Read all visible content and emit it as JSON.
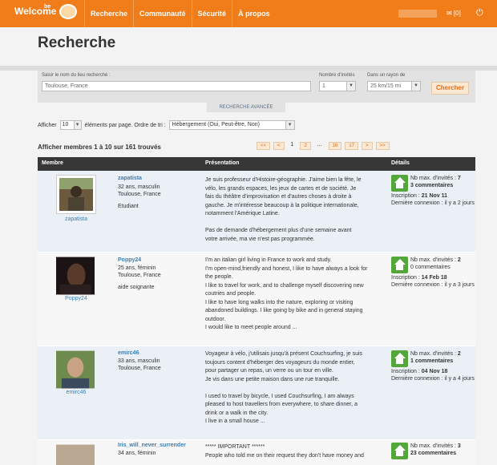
{
  "nav": {
    "logo": "Welcome",
    "logo_sup": "be",
    "items": [
      "Recherche",
      "Communauté",
      "Sécurité",
      "À propos"
    ],
    "messages": "[0]"
  },
  "page": {
    "title": "Recherche"
  },
  "search": {
    "place_label": "Saisir le nom du lieu recherché :",
    "place_value": "Toulouse, France",
    "guests_label": "Nombre d'invités",
    "guests_value": "1",
    "radius_label": "Dans un rayon de",
    "radius_value": "25 km/15 mi",
    "button": "Chercher",
    "advanced": "RECHERCHE AVANCÉE"
  },
  "listing": {
    "show_label": "Afficher",
    "per_page": "10",
    "per_page_label": "éléments par page. Ordre de tri :",
    "sort_value": "Hébergement (Oui, Peut-être, Non)",
    "results": "Afficher membres 1 à 10 sur 161 trouvés",
    "pager": [
      "<<",
      "<",
      "1",
      "2",
      "...",
      "16",
      "17",
      ">",
      ">>"
    ]
  },
  "table": {
    "headers": {
      "member": "Membre",
      "presentation": "Présentation",
      "details": "Détails"
    },
    "rows": [
      {
        "username": "zapatista",
        "age_gender": "32 ans, masculin",
        "location": "Toulouse, France",
        "occupation": "Etudiant",
        "presentation": [
          "Je suis professeur d'Histoire-géographie. J'aime bien la fête, le",
          "vélo, les grands espaces, les jeux de cartes et de société. Je",
          "fais du théâtre d'improvisation et d'autres choses à droite à",
          "gauche. Je m'intéresse beaucoup à la politique internationale,",
          "notamment l'Amérique Latine.",
          "",
          "Pas de demande d'hébergement plus d'une semaine avant",
          "votre arrivée, ma vie n'est pas programmée."
        ],
        "max_guests_label": "Nb max. d'invités :",
        "max_guests": "7",
        "comments": "3 commentaires",
        "signup_label": "Inscription :",
        "signup": "21 Nov 11",
        "last_login": "Dernière connexion : il y a 2 jours"
      },
      {
        "username": "Poppy24",
        "age_gender": "25 ans, féminin",
        "location": "Toulouse, France",
        "occupation": "aide soignante",
        "presentation": [
          "I'm an italian girl living in France to work and study.",
          "I'm open-mind,friendly and honest, I like to have always a look for",
          "the people.",
          "I like to travel for work, and to challenge myself discovering new",
          "coutries and people.",
          "I like to have long walks into the nature, exploring or visiting",
          "abandoned buildings. I like going by bike and in general staying",
          "outdoor.",
          "I would like to meet people around ..."
        ],
        "max_guests_label": "Nb max. d'invités :",
        "max_guests": "2",
        "comments": "0 commentaires",
        "signup_label": "Inscription :",
        "signup": "14 Feb 18",
        "last_login": "Dernière connexion : il y a 3 jours"
      },
      {
        "username": "emirc46",
        "age_gender": "33 ans, masculin",
        "location": "Toulouse, France",
        "occupation": "",
        "presentation": [
          "Voyageur à vélo, j'utilisais jusqu'à présent Couchsurfing, je suis",
          "toujours content d'héberger des voyageurs du monde entier,",
          "pour partager un repas, un verre ou un tour en ville.",
          "Je vis dans une petite maison dans une rue tranquille.",
          "",
          "I used to travel by bicycle, I used Couchsurfing, I am always",
          "pleased to host travellers from everywhere, to share dinner, a",
          "drink or a walk in the city.",
          "I live in a small house ..."
        ],
        "max_guests_label": "Nb max. d'invités :",
        "max_guests": "2",
        "comments": "1 commentaires",
        "signup_label": "Inscription :",
        "signup": "04 Nov 18",
        "last_login": "Dernière connexion : il y a 4 jours"
      },
      {
        "username": "Iris_will_never_surrender",
        "age_gender": "34 ans, féminin",
        "location": "",
        "occupation": "",
        "presentation": [
          "***** IMPORTANT ******",
          "People who told me on their request they don't have money and"
        ],
        "max_guests_label": "Nb max. d'invités :",
        "max_guests": "3",
        "comments": "23 commentaires",
        "signup_label": "",
        "signup": "",
        "last_login": ""
      }
    ]
  },
  "colors": {
    "brand_orange": "#f07d1a",
    "table_header": "#373737",
    "link_blue": "#3a7fb5",
    "host_green": "#53a63a"
  }
}
